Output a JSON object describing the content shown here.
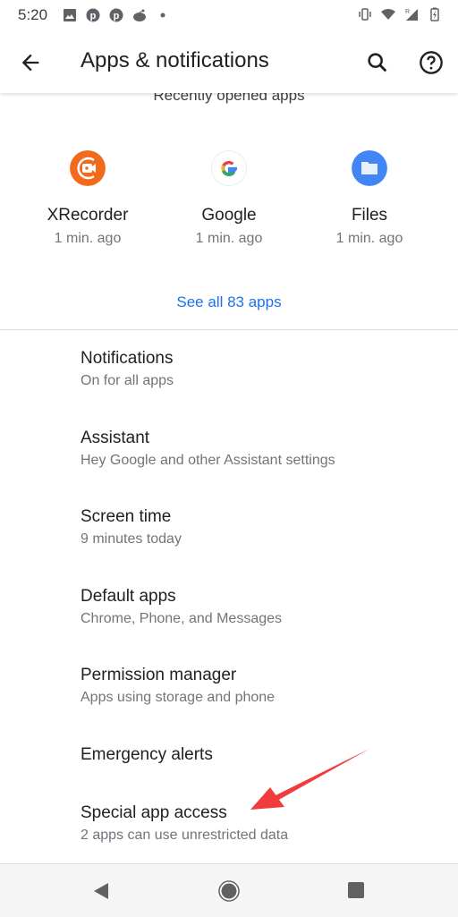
{
  "status_bar": {
    "time": "5:20",
    "left_icons": [
      "image-icon",
      "pinterest-icon",
      "pinterest-icon",
      "reddit-icon",
      "dot-icon"
    ],
    "right_icons": [
      "vibrate-icon",
      "wifi-icon",
      "signal-roaming-icon",
      "battery-charging-icon"
    ],
    "roaming_label": "R"
  },
  "app_bar": {
    "title": "Apps & notifications"
  },
  "recent": {
    "header": "Recently opened apps",
    "apps": [
      {
        "name": "XRecorder",
        "time": "1 min. ago",
        "color": "#f26b1d"
      },
      {
        "name": "Google",
        "time": "1 min. ago",
        "color": "#ffffff"
      },
      {
        "name": "Files",
        "time": "1 min. ago",
        "color": "#4285f4"
      }
    ],
    "see_all": "See all 83 apps"
  },
  "settings": [
    {
      "title": "Notifications",
      "subtitle": "On for all apps"
    },
    {
      "title": "Assistant",
      "subtitle": "Hey Google and other Assistant settings"
    },
    {
      "title": "Screen time",
      "subtitle": "9 minutes today"
    },
    {
      "title": "Default apps",
      "subtitle": "Chrome, Phone, and Messages"
    },
    {
      "title": "Permission manager",
      "subtitle": "Apps using storage and phone"
    },
    {
      "title": "Emergency alerts",
      "subtitle": ""
    },
    {
      "title": "Special app access",
      "subtitle": "2 apps can use unrestricted data"
    }
  ],
  "colors": {
    "accent": "#1a73e8",
    "annotation_arrow": "#f03c3c"
  }
}
